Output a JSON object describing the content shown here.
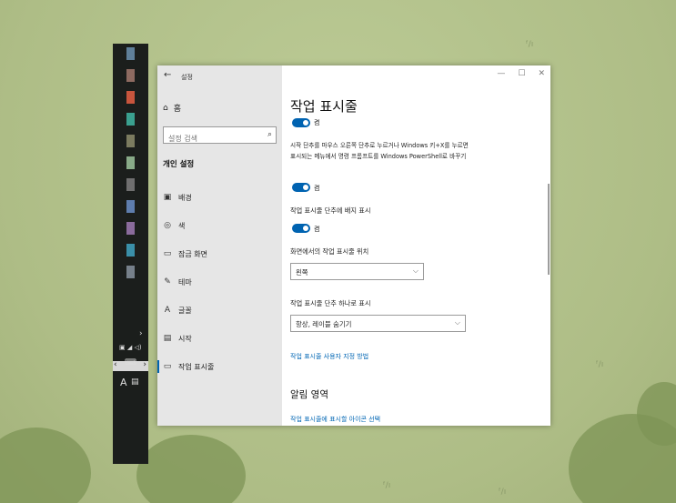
{
  "window": {
    "title": "설정",
    "controls": {
      "minimize": "—",
      "maximize": "☐",
      "close": "✕"
    }
  },
  "sidebar": {
    "back": "←",
    "home_label": "홈",
    "search_placeholder": "설정 검색",
    "section_heading": "개인 설정",
    "items": [
      {
        "icon": "picture-icon",
        "glyph": "▣",
        "label": "배경"
      },
      {
        "icon": "palette-icon",
        "glyph": "◎",
        "label": "색"
      },
      {
        "icon": "lock-screen-icon",
        "glyph": "▭",
        "label": "잠금 화면"
      },
      {
        "icon": "theme-icon",
        "glyph": "✎",
        "label": "테마"
      },
      {
        "icon": "font-icon",
        "glyph": "A",
        "label": "글꼴"
      },
      {
        "icon": "start-icon",
        "glyph": "▤",
        "label": "시작"
      },
      {
        "icon": "taskbar-icon",
        "glyph": "▭",
        "label": "작업 표시줄",
        "active": true
      }
    ]
  },
  "main": {
    "title": "작업 표시줄",
    "top_toggle_state": "켬",
    "powershell_desc": "시작 단추를 마우스 오른쪽 단추로 누르거나 Windows 키+X를 누르면 표시되는 메뉴에서 명령 프롬프트를 Windows PowerShell로 바꾸기",
    "powershell_state": "켬",
    "badge_label": "작업 표시줄 단추에 배지 표시",
    "badge_state": "켬",
    "position_label": "화면에서의 작업 표시줄 위치",
    "position_value": "왼쪽",
    "combine_label": "작업 표시줄 단추 하나로 표시",
    "combine_value": "항상, 레이블 숨기기",
    "customize_link": "작업 표시줄 사용자 지정 방법",
    "notification_heading": "알림 영역",
    "notification_link": "작업 표시줄에 표시할 아이콘 선택"
  },
  "taskbar": {
    "icon_colors": [
      "#5f7f99",
      "#8d6a60",
      "#c8553d",
      "#3aa08f",
      "#7b7b5f",
      "#88aa88",
      "#6f6f6f",
      "#5e7dad",
      "#8a6b9c",
      "#3a8fa8",
      "#76808a"
    ],
    "scroll_left": "‹",
    "scroll_right": "›",
    "expand": "›",
    "sys_icons": "▣ ◢ ◁)",
    "keyboard": "⌨",
    "ime": "A",
    "notification": "▤"
  },
  "colors": {
    "accent": "#0063b1",
    "link": "#0066b4",
    "desktop": "#b5c38e"
  }
}
